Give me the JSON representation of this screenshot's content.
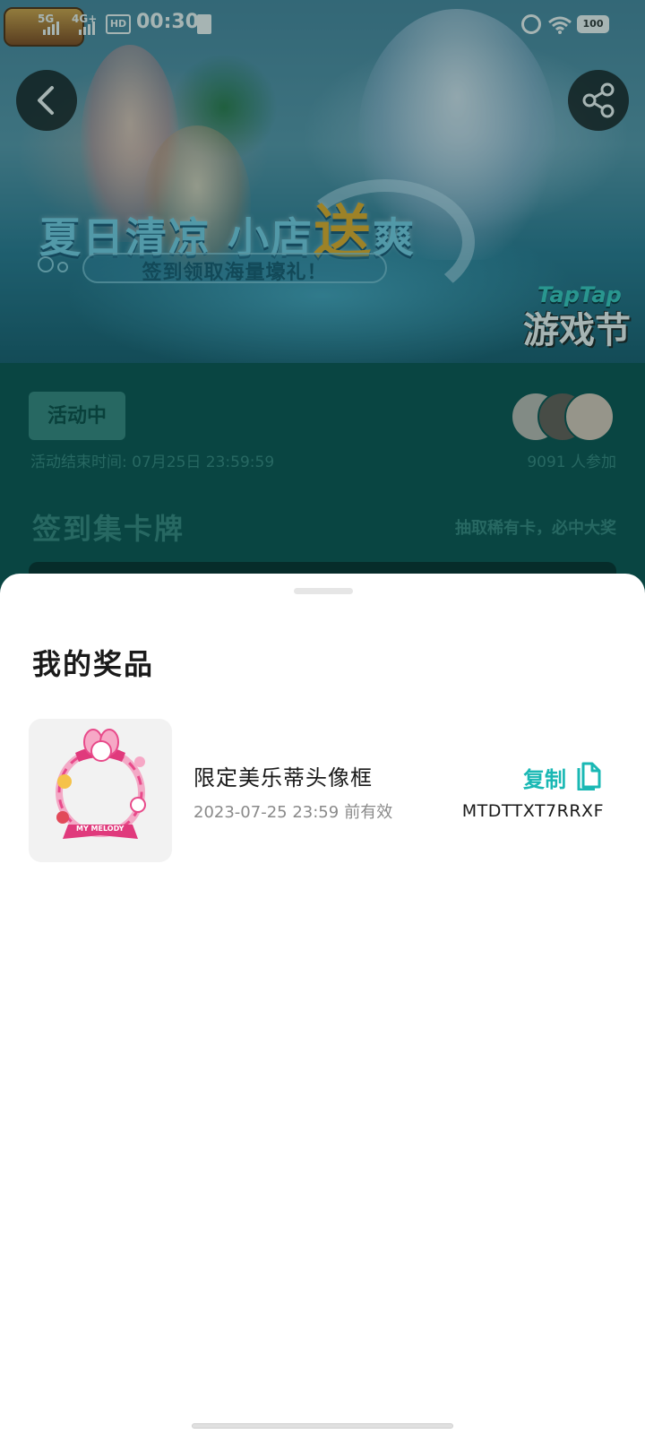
{
  "status_bar": {
    "network_1": "5G",
    "network_2": "4G+",
    "hd_label": "HD",
    "time": "00:30",
    "battery": "100"
  },
  "banner": {
    "title_part1": "夏日清凉 小店",
    "title_highlight": "送",
    "title_part2": "爽",
    "subtitle": "签到领取海量壕礼！",
    "brand_top": "TapTap",
    "brand_bottom": "游戏节"
  },
  "activity": {
    "status": "活动中",
    "end_time": "活动结束时间: 07月25日  23:59:59",
    "participants": "9091 人参加",
    "section_title": "签到集卡牌",
    "section_subtitle": "抽取稀有卡，必中大奖"
  },
  "sheet": {
    "title": "我的奖品",
    "prizes": [
      {
        "name": "限定美乐蒂头像框",
        "expire_date": "2023-07-25  23:59",
        "expire_suffix": "前有效",
        "copy_label": "复制",
        "code": "MTDTTXT7RRXF",
        "thumb_text": "MY MELODY"
      }
    ]
  },
  "colors": {
    "accent": "#1ab8b4",
    "teal_dark": "#0f5552"
  }
}
